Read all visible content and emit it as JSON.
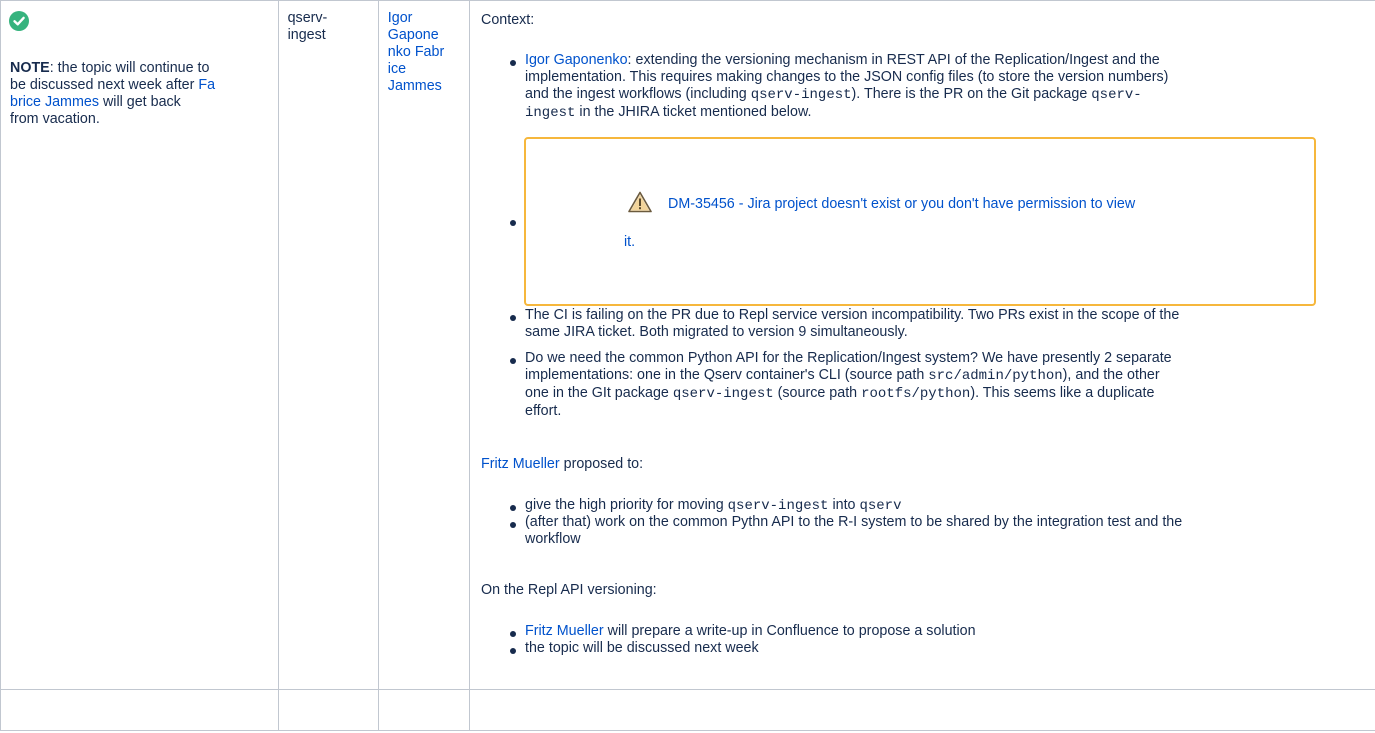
{
  "row": {
    "status": {
      "icon": "check-circle-icon",
      "note_bold": "NOTE",
      "note_text_1": ": the topic will continue to",
      "note_text_2": "be discussed next week after ",
      "note_link_1": "Fa",
      "note_link_2": "brice Jammes",
      "note_text_3": " will get back",
      "note_text_4": "from vacation."
    },
    "topic": {
      "line1": "qserv-",
      "line2": "ingest"
    },
    "who": {
      "lines": [
        "Igor",
        "Gapone",
        "nko Fabr",
        "ice",
        "Jammes"
      ]
    },
    "notes": {
      "context_label": "Context:",
      "item1": {
        "person": "Igor Gaponenko",
        "line1": ": extending the versioning mechanism in REST API of the Replication/Ingest and the",
        "line2": "implementation. This requires making changes to the JSON config files (to store the version numbers)",
        "line3a": "and the ingest workflows (including ",
        "line3b": "qserv-ingest",
        "line3c": "). There is the PR on the Git package ",
        "line3d": "qserv-",
        "line4a": "ingest",
        "line4b": " in the JHIRA ticket mentioned below."
      },
      "jira": {
        "icon": "warning-icon",
        "key": "DM-35456",
        "message": " - Jira project doesn't exist or you don't have permission to view",
        "message_end": "it."
      },
      "item3": {
        "line1": "The CI is failing on the PR due to Repl service version incompatibility. Two PRs exist in the scope of the",
        "line2": "same JIRA ticket. Both migrated to version 9 simultaneously."
      },
      "item4": {
        "line1": "Do we need the common Python API for the Replication/Ingest system? We have presently 2 separate",
        "line2a": "implementations: one in the Qserv container's CLI (source path ",
        "line2b": "src/admin/python",
        "line2c": "), and the other",
        "line3a": "one in the GIt package ",
        "line3b": "qserv-ingest",
        "line3c": " (source path ",
        "line3d": "rootfs/python",
        "line3e": "). This seems like a duplicate",
        "line4": "effort."
      },
      "proposal": {
        "person": "Fritz Mueller",
        "text": " proposed to:",
        "items": [
          {
            "a": "give the high priority for moving ",
            "b": "qserv-ingest",
            "c": " into ",
            "d": "qserv"
          },
          {
            "line1": "(after that) work on the common Pythn API to the R-I system to be shared by the integration test and the",
            "line2": "workflow"
          }
        ]
      },
      "versioning": {
        "label": "On the Repl API versioning:",
        "item1_person": "Fritz Mueller",
        "item1_text": " will prepare a write-up in Confluence to propose a solution",
        "item2": "the topic will be discussed next week"
      }
    }
  },
  "colors": {
    "link": "#0052cc",
    "text": "#172b4d",
    "border": "#c1c7d0",
    "check": "#36b37e",
    "jira_border": "#f6b73c"
  }
}
